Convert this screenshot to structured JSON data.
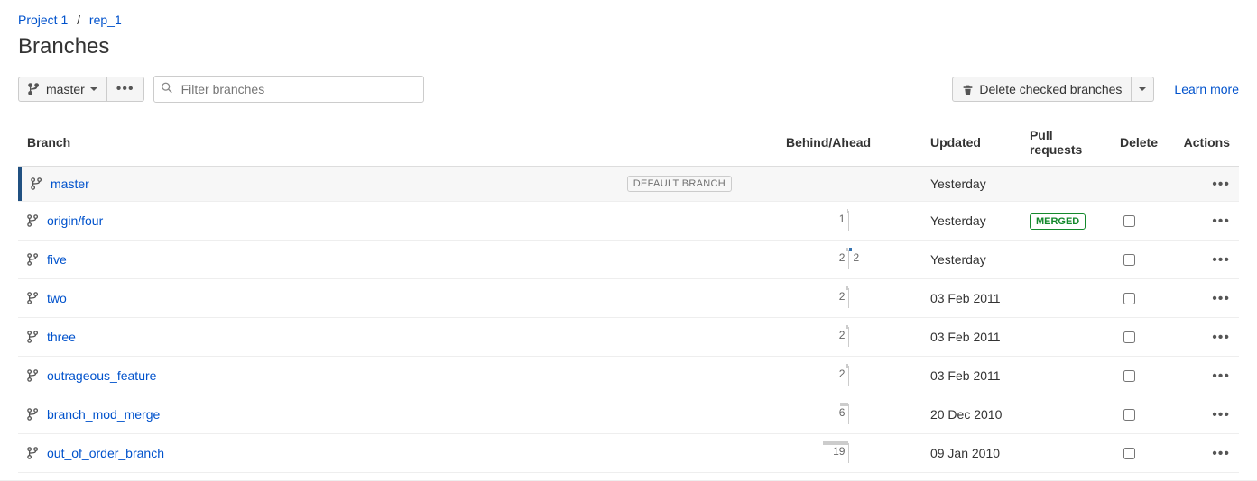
{
  "breadcrumb": {
    "project": "Project 1",
    "repo": "rep_1"
  },
  "page_title": "Branches",
  "toolbar": {
    "branch_selector": "master",
    "filter_placeholder": "Filter branches",
    "delete_checked": "Delete checked branches",
    "learn_more": "Learn more"
  },
  "columns": {
    "branch": "Branch",
    "behind_ahead": "Behind/Ahead",
    "updated": "Updated",
    "pull_requests": "Pull requests",
    "delete": "Delete",
    "actions": "Actions"
  },
  "badges": {
    "default_branch": "DEFAULT BRANCH",
    "merged": "MERGED"
  },
  "branches": [
    {
      "name": "master",
      "behind": null,
      "ahead": null,
      "updated": "Yesterday",
      "pr": null,
      "is_default": true,
      "deleteable": false
    },
    {
      "name": "origin/four",
      "behind": 1,
      "ahead": null,
      "updated": "Yesterday",
      "pr": "MERGED",
      "is_default": false,
      "deleteable": true
    },
    {
      "name": "five",
      "behind": 2,
      "ahead": 2,
      "updated": "Yesterday",
      "pr": null,
      "is_default": false,
      "deleteable": true
    },
    {
      "name": "two",
      "behind": 2,
      "ahead": null,
      "updated": "03 Feb 2011",
      "pr": null,
      "is_default": false,
      "deleteable": true
    },
    {
      "name": "three",
      "behind": 2,
      "ahead": null,
      "updated": "03 Feb 2011",
      "pr": null,
      "is_default": false,
      "deleteable": true
    },
    {
      "name": "outrageous_feature",
      "behind": 2,
      "ahead": null,
      "updated": "03 Feb 2011",
      "pr": null,
      "is_default": false,
      "deleteable": true
    },
    {
      "name": "branch_mod_merge",
      "behind": 6,
      "ahead": null,
      "updated": "20 Dec 2010",
      "pr": null,
      "is_default": false,
      "deleteable": true
    },
    {
      "name": "out_of_order_branch",
      "behind": 19,
      "ahead": null,
      "updated": "09 Jan 2010",
      "pr": null,
      "is_default": false,
      "deleteable": true
    }
  ]
}
